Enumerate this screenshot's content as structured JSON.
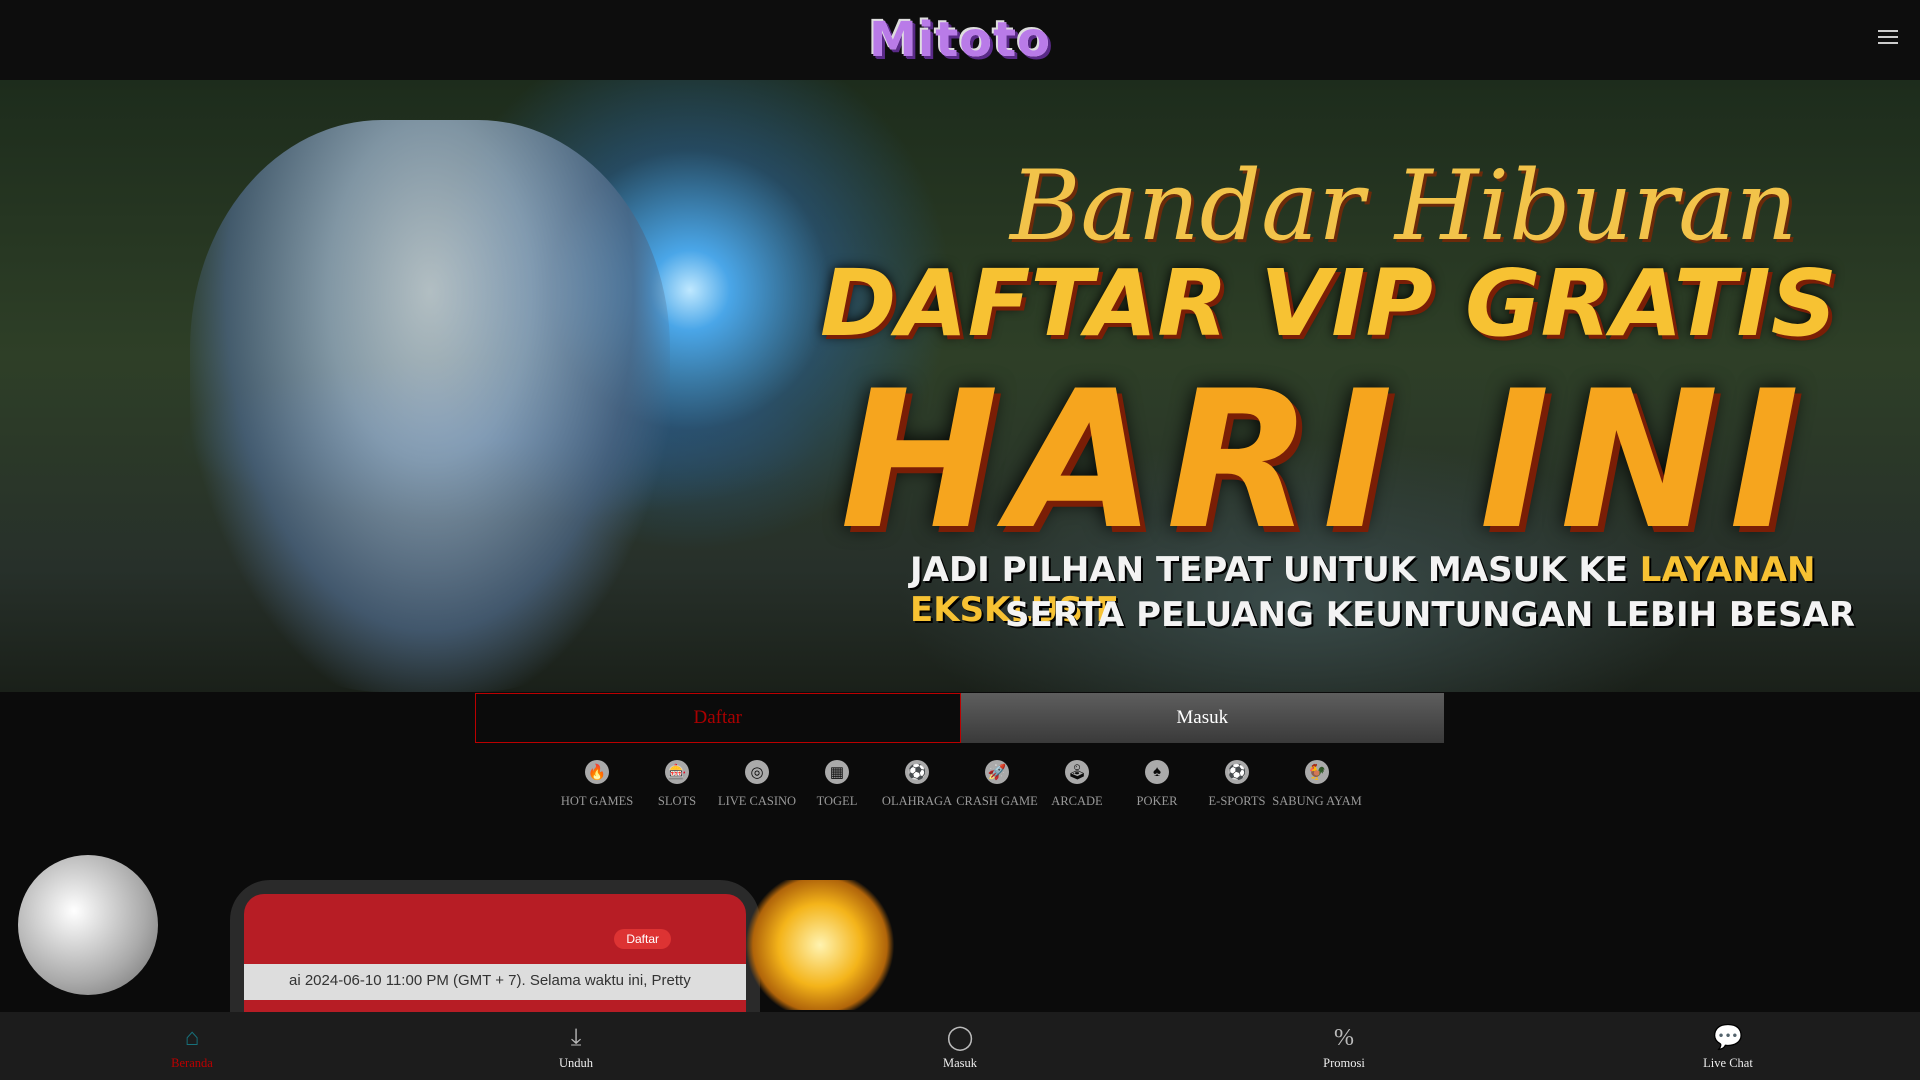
{
  "header": {
    "logo": "Mitoto",
    "menu_icon": "hamburger-icon"
  },
  "banner": {
    "line1": "Bandar Hiburan",
    "line2": "DAFTAR VIP GRATIS",
    "line3": "HARI INI",
    "line4a": "JADI PILHAN TEPAT UNTUK MASUK KE ",
    "line4b": "LAYANAN EKSKLUSIF",
    "line5": "SERTA PELUANG KEUNTUNGAN LEBIH BESAR"
  },
  "auth": {
    "daftar": "Daftar",
    "masuk": "Masuk"
  },
  "categories": [
    {
      "label": "HOT GAMES",
      "icon": "🔥"
    },
    {
      "label": "SLOTS",
      "icon": "🎰"
    },
    {
      "label": "LIVE CASINO",
      "icon": "◎"
    },
    {
      "label": "TOGEL",
      "icon": "▦"
    },
    {
      "label": "OLAHRAGA",
      "icon": "⚽"
    },
    {
      "label": "CRASH GAME",
      "icon": "🚀"
    },
    {
      "label": "ARCADE",
      "icon": "🕹"
    },
    {
      "label": "POKER",
      "icon": "♠"
    },
    {
      "label": "E-SPORTS",
      "icon": "⚽"
    },
    {
      "label": "SABUNG AYAM",
      "icon": "🐓"
    }
  ],
  "promo": {
    "phone_button": "Daftar",
    "ticker": "ai 2024-06-10 11:00 PM (GMT + 7). Selama waktu ini, Pretty"
  },
  "bottom_nav": [
    {
      "label": "Beranda",
      "icon": "⌂"
    },
    {
      "label": "Unduh",
      "icon": "⤓"
    },
    {
      "label": "Masuk",
      "icon": "◯"
    },
    {
      "label": "Promosi",
      "icon": "%"
    },
    {
      "label": "Live Chat",
      "icon": "💬"
    }
  ],
  "colors": {
    "accent": "#b00000",
    "active_icon": "#17707a"
  }
}
